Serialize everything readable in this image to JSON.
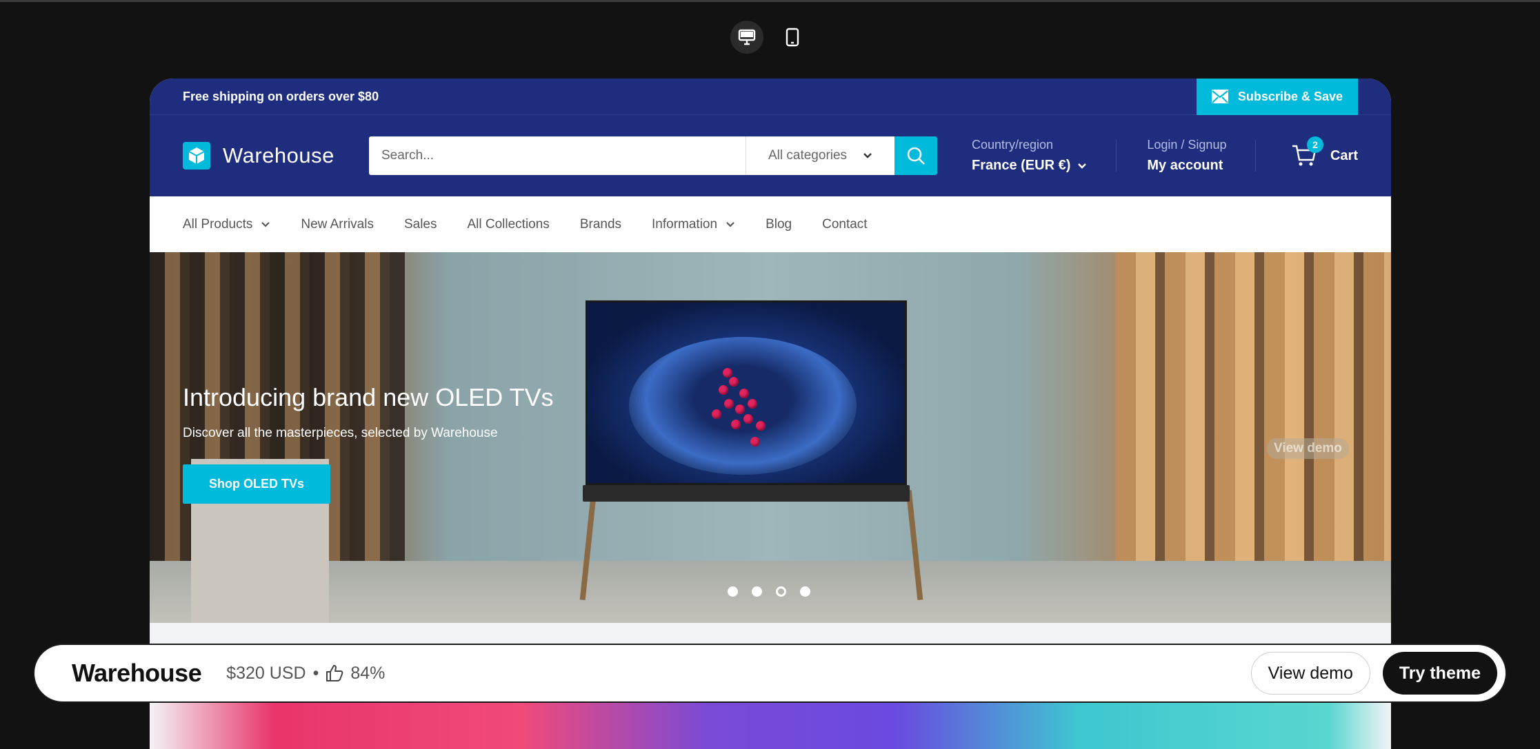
{
  "announcement": {
    "text": "Free shipping on orders over $80",
    "subscribe_label": "Subscribe & Save"
  },
  "header": {
    "logo_text": "Warehouse",
    "search": {
      "placeholder": "Search...",
      "category": "All categories"
    },
    "country": {
      "label": "Country/region",
      "value": "France (EUR €)"
    },
    "account": {
      "label": "Login / Signup",
      "value": "My account"
    },
    "cart": {
      "count": "2",
      "label": "Cart"
    }
  },
  "nav": [
    {
      "label": "All Products"
    },
    {
      "label": "New Arrivals"
    },
    {
      "label": "Sales"
    },
    {
      "label": "All Collections"
    },
    {
      "label": "Brands"
    },
    {
      "label": "Information"
    },
    {
      "label": "Blog"
    },
    {
      "label": "Contact"
    }
  ],
  "hero": {
    "title": "Introducing brand new OLED TVs",
    "subtitle": "Discover all the masterpieces, selected by Warehouse",
    "cta": "Shop OLED TVs",
    "overlay_label": "View demo",
    "slide_count": 4,
    "active_slide": 3
  },
  "bottombar": {
    "theme_name": "Warehouse",
    "price": "$320 USD",
    "separator": "•",
    "rating": "84%",
    "view_demo": "View demo",
    "try_theme": "Try theme"
  },
  "colors": {
    "brand_navy": "#1e2d7d",
    "accent_cyan": "#00badb"
  },
  "icons": [
    "desktop-icon",
    "mobile-icon",
    "mail-icon",
    "cube-logo-icon",
    "search-icon",
    "chevron-down-icon",
    "cart-icon",
    "thumbs-up-icon"
  ]
}
